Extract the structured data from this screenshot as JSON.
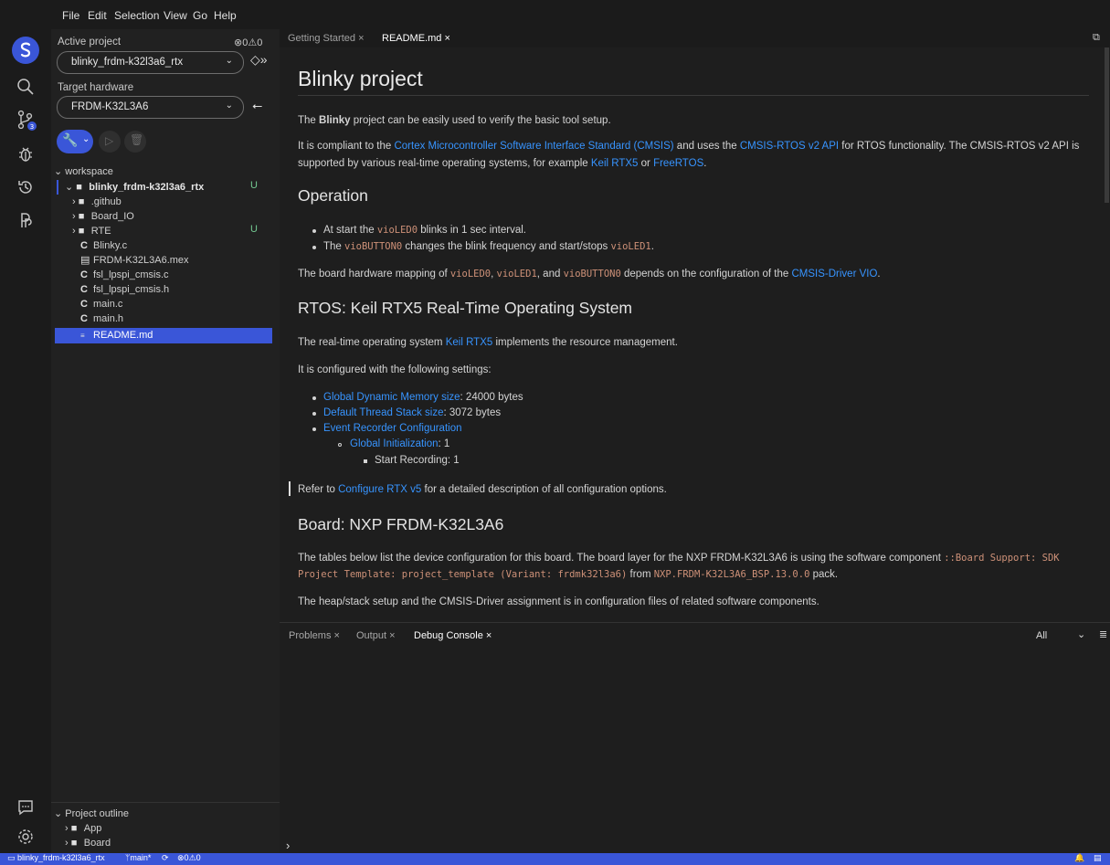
{
  "menu": [
    "File",
    "Edit",
    "Selection",
    "View",
    "Go",
    "Help"
  ],
  "activity": [
    "csolution-icon",
    "search-icon",
    "source-control-icon",
    "debug-icon",
    "history-icon",
    "extensions-icon",
    "chat-icon",
    "settings-icon"
  ],
  "scm_badge": "3",
  "sidebar": {
    "active_project_label": "Active project",
    "errors": "0",
    "warnings": "0",
    "project_value": "blinky_frdm-k32l3a6_rtx",
    "target_label": "Target hardware",
    "target_value": "FRDM-K32L3A6",
    "workspace_label": "workspace",
    "tree": [
      {
        "text": "blinky_frdm-k32l3a6_rtx",
        "kind": "folder-open",
        "bold": true,
        "git": "U"
      },
      {
        "text": ".github",
        "kind": "folder"
      },
      {
        "text": "Board_IO",
        "kind": "folder"
      },
      {
        "text": "RTE",
        "kind": "folder",
        "git": "U"
      },
      {
        "text": "Blinky.c",
        "kind": "c"
      },
      {
        "text": "FRDM-K32L3A6.mex",
        "kind": "file"
      },
      {
        "text": "fsl_lpspi_cmsis.c",
        "kind": "c"
      },
      {
        "text": "fsl_lpspi_cmsis.h",
        "kind": "c"
      },
      {
        "text": "main.c",
        "kind": "c"
      },
      {
        "text": "main.h",
        "kind": "c"
      },
      {
        "text": "README.md",
        "kind": "md",
        "selected": true
      }
    ],
    "outline_label": "Project outline",
    "outline": [
      "App",
      "Board"
    ]
  },
  "tabs": {
    "getting_started": "Getting Started",
    "readme": "README.md",
    "close": "×"
  },
  "doc": {
    "h1": "Blinky project",
    "p1_a": "The ",
    "p1_b": "Blinky",
    "p1_c": " project can be easily used to verify the basic tool setup.",
    "p2_a": "It is compliant to the ",
    "p2_link1": "Cortex Microcontroller Software Interface Standard (CMSIS)",
    "p2_b": " and uses the ",
    "p2_link2": "CMSIS-RTOS v2 API",
    "p2_c": " for RTOS functionality. The CMSIS-RTOS v2 API is",
    "p2_d": "supported by various real-time operating systems, for example ",
    "p2_link3": "Keil RTX5",
    "p2_e": " or ",
    "p2_link4": "FreeRTOS",
    "p2_f": ".",
    "h2_op": "Operation",
    "li1_a": "At start the ",
    "li1_code": "vioLED0",
    "li1_b": " blinks in 1 sec interval.",
    "li2_a": "The ",
    "li2_code": "vioBUTTON0",
    "li2_b": " changes the blink frequency and start/stops ",
    "li2_code2": "vioLED1",
    "li2_c": ".",
    "p3_a": "The board hardware mapping of ",
    "p3_c1": "vioLED0",
    "p3_sep1": ", ",
    "p3_c2": "vioLED1",
    "p3_sep2": ", and ",
    "p3_c3": "vioBUTTON0",
    "p3_b": " depends on the configuration of the ",
    "p3_link": "CMSIS-Driver VIO",
    "p3_end": ".",
    "h2_rtos": "RTOS: Keil RTX5 Real-Time Operating System",
    "p4_a": "The real-time operating system ",
    "p4_link": "Keil RTX5",
    "p4_b": " implements the resource management.",
    "p5": "It is configured with the following settings:",
    "s1_link": "Global Dynamic Memory size",
    "s1_val": ": 24000 bytes",
    "s2_link": "Default Thread Stack size",
    "s2_val": ": 3072 bytes",
    "s3_link": "Event Recorder Configuration",
    "s4_link": "Global Initialization",
    "s4_val": ": 1",
    "s5": "Start Recording: 1",
    "p6_a": "Refer to ",
    "p6_link": "Configure RTX v5",
    "p6_b": " for a detailed description of all configuration options.",
    "h2_board": "Board: NXP FRDM-K32L3A6",
    "p7_a": "The tables below list the device configuration for this board. The board layer for the NXP FRDM-K32L3A6 is using the software component ",
    "p7_code": "::Board Support: SDK",
    "p7_code2": "Project Template: project_template (Variant: frdmk32l3a6)",
    "p7_b": " from ",
    "p7_code3": "NXP.FRDM-K32L3A6_BSP.13.0.0",
    "p7_c": " pack.",
    "p8": "The heap/stack setup and the CMSIS-Driver assignment is in configuration files of related software components."
  },
  "panel": {
    "problems": "Problems",
    "output": "Output",
    "debug_console": "Debug Console",
    "close": "×",
    "filter": "All",
    "prompt": "›"
  },
  "status": {
    "folder": "blinky_frdm-k32l3a6_rtx",
    "branch": "main*",
    "errors": "0",
    "warnings": "0"
  },
  "colors": {
    "accent": "#3a56d8",
    "link": "#3794ff",
    "code": "#ce9178",
    "git_untracked": "#73c991",
    "selection": "#3a56d8"
  }
}
